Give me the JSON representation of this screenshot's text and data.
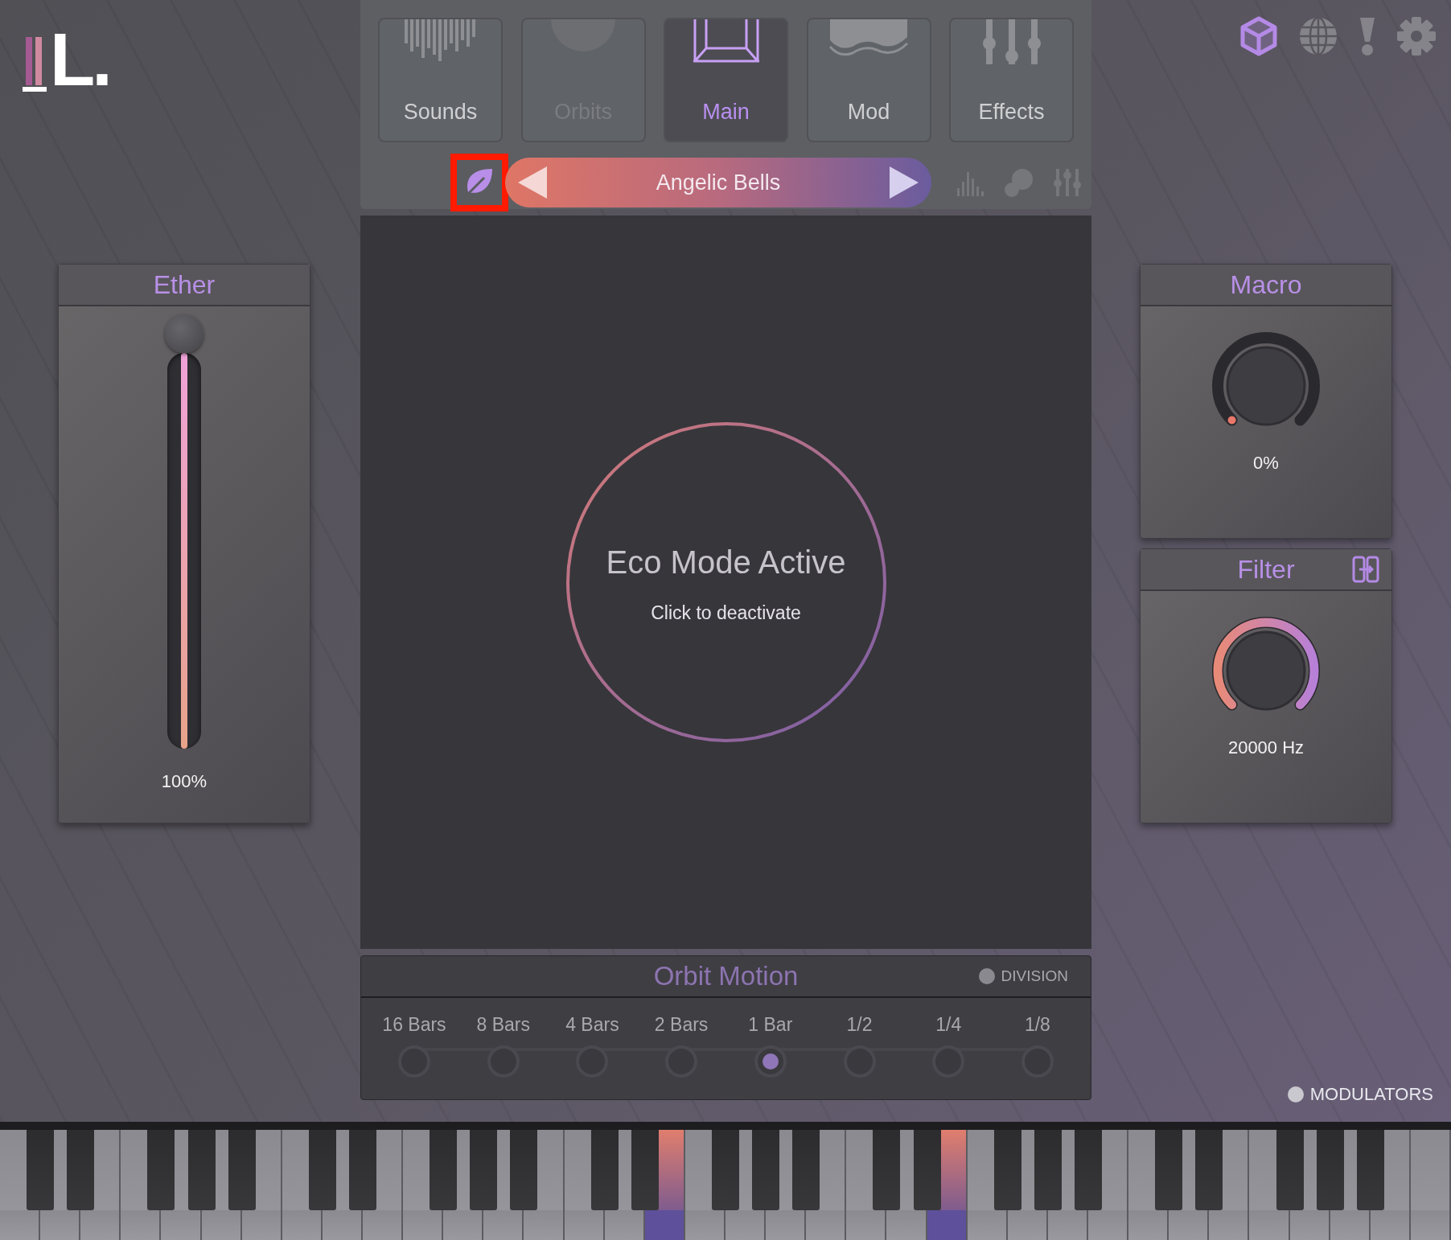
{
  "logo": {
    "letters": "L."
  },
  "toolbar_icons": [
    {
      "kind": "cube",
      "selected": true
    },
    {
      "kind": "globe",
      "selected": false
    },
    {
      "kind": "alert",
      "selected": false
    },
    {
      "kind": "gear",
      "selected": false
    }
  ],
  "tabs": [
    {
      "label": "Sounds",
      "kind": "sounds",
      "selected": false,
      "disabled": false
    },
    {
      "label": "Orbits",
      "kind": "orbits",
      "selected": false,
      "disabled": true
    },
    {
      "label": "Main",
      "kind": "main",
      "selected": true,
      "disabled": false
    },
    {
      "label": "Mod",
      "kind": "mod",
      "selected": false,
      "disabled": false
    },
    {
      "label": "Effects",
      "kind": "effects",
      "selected": false,
      "disabled": false
    }
  ],
  "eco_button": {
    "highlighted": true
  },
  "preset": {
    "name": "Angelic Bells"
  },
  "view_icons": [
    {
      "kind": "bars"
    },
    {
      "kind": "bubbles"
    },
    {
      "kind": "sliders"
    }
  ],
  "eco_mode": {
    "title": "Eco Mode Active",
    "subtitle": "Click to deactivate"
  },
  "ether": {
    "title": "Ether",
    "level": 1,
    "reading": "100%"
  },
  "macro": {
    "title": "Macro",
    "level": 0,
    "reading": "0%"
  },
  "filter": {
    "title": "Filter",
    "level": 1,
    "reading": "20000 Hz"
  },
  "orbit_motion": {
    "title": "Orbit Motion",
    "division": {
      "label": "DIVISION",
      "on": false
    },
    "steps": [
      {
        "label": "16 Bars",
        "selected": false
      },
      {
        "label": "8 Bars",
        "selected": false
      },
      {
        "label": "4 Bars",
        "selected": false
      },
      {
        "label": "2 Bars",
        "selected": false
      },
      {
        "label": "1 Bar",
        "selected": true
      },
      {
        "label": "1/2",
        "selected": false
      },
      {
        "label": "1/4",
        "selected": false
      },
      {
        "label": "1/8",
        "selected": false
      }
    ]
  },
  "modulators": {
    "label": "MODULATORS",
    "on": false
  },
  "keyboard": {
    "white_keys": [
      {
        "pressed": false
      },
      {
        "pressed": false
      },
      {
        "pressed": false
      },
      {
        "pressed": false
      },
      {
        "pressed": false
      },
      {
        "pressed": false
      },
      {
        "pressed": false
      },
      {
        "pressed": false
      },
      {
        "pressed": false
      },
      {
        "pressed": false
      },
      {
        "pressed": false
      },
      {
        "pressed": false
      },
      {
        "pressed": false
      },
      {
        "pressed": false
      },
      {
        "pressed": false
      },
      {
        "pressed": false
      },
      {
        "pressed": true
      },
      {
        "pressed": false
      },
      {
        "pressed": false
      },
      {
        "pressed": false
      },
      {
        "pressed": false
      },
      {
        "pressed": false
      },
      {
        "pressed": false
      },
      {
        "pressed": true
      },
      {
        "pressed": false
      },
      {
        "pressed": false
      },
      {
        "pressed": false
      },
      {
        "pressed": false
      },
      {
        "pressed": false
      },
      {
        "pressed": false
      },
      {
        "pressed": false
      },
      {
        "pressed": false
      },
      {
        "pressed": false
      },
      {
        "pressed": false
      },
      {
        "pressed": false
      },
      {
        "pressed": false
      }
    ]
  }
}
